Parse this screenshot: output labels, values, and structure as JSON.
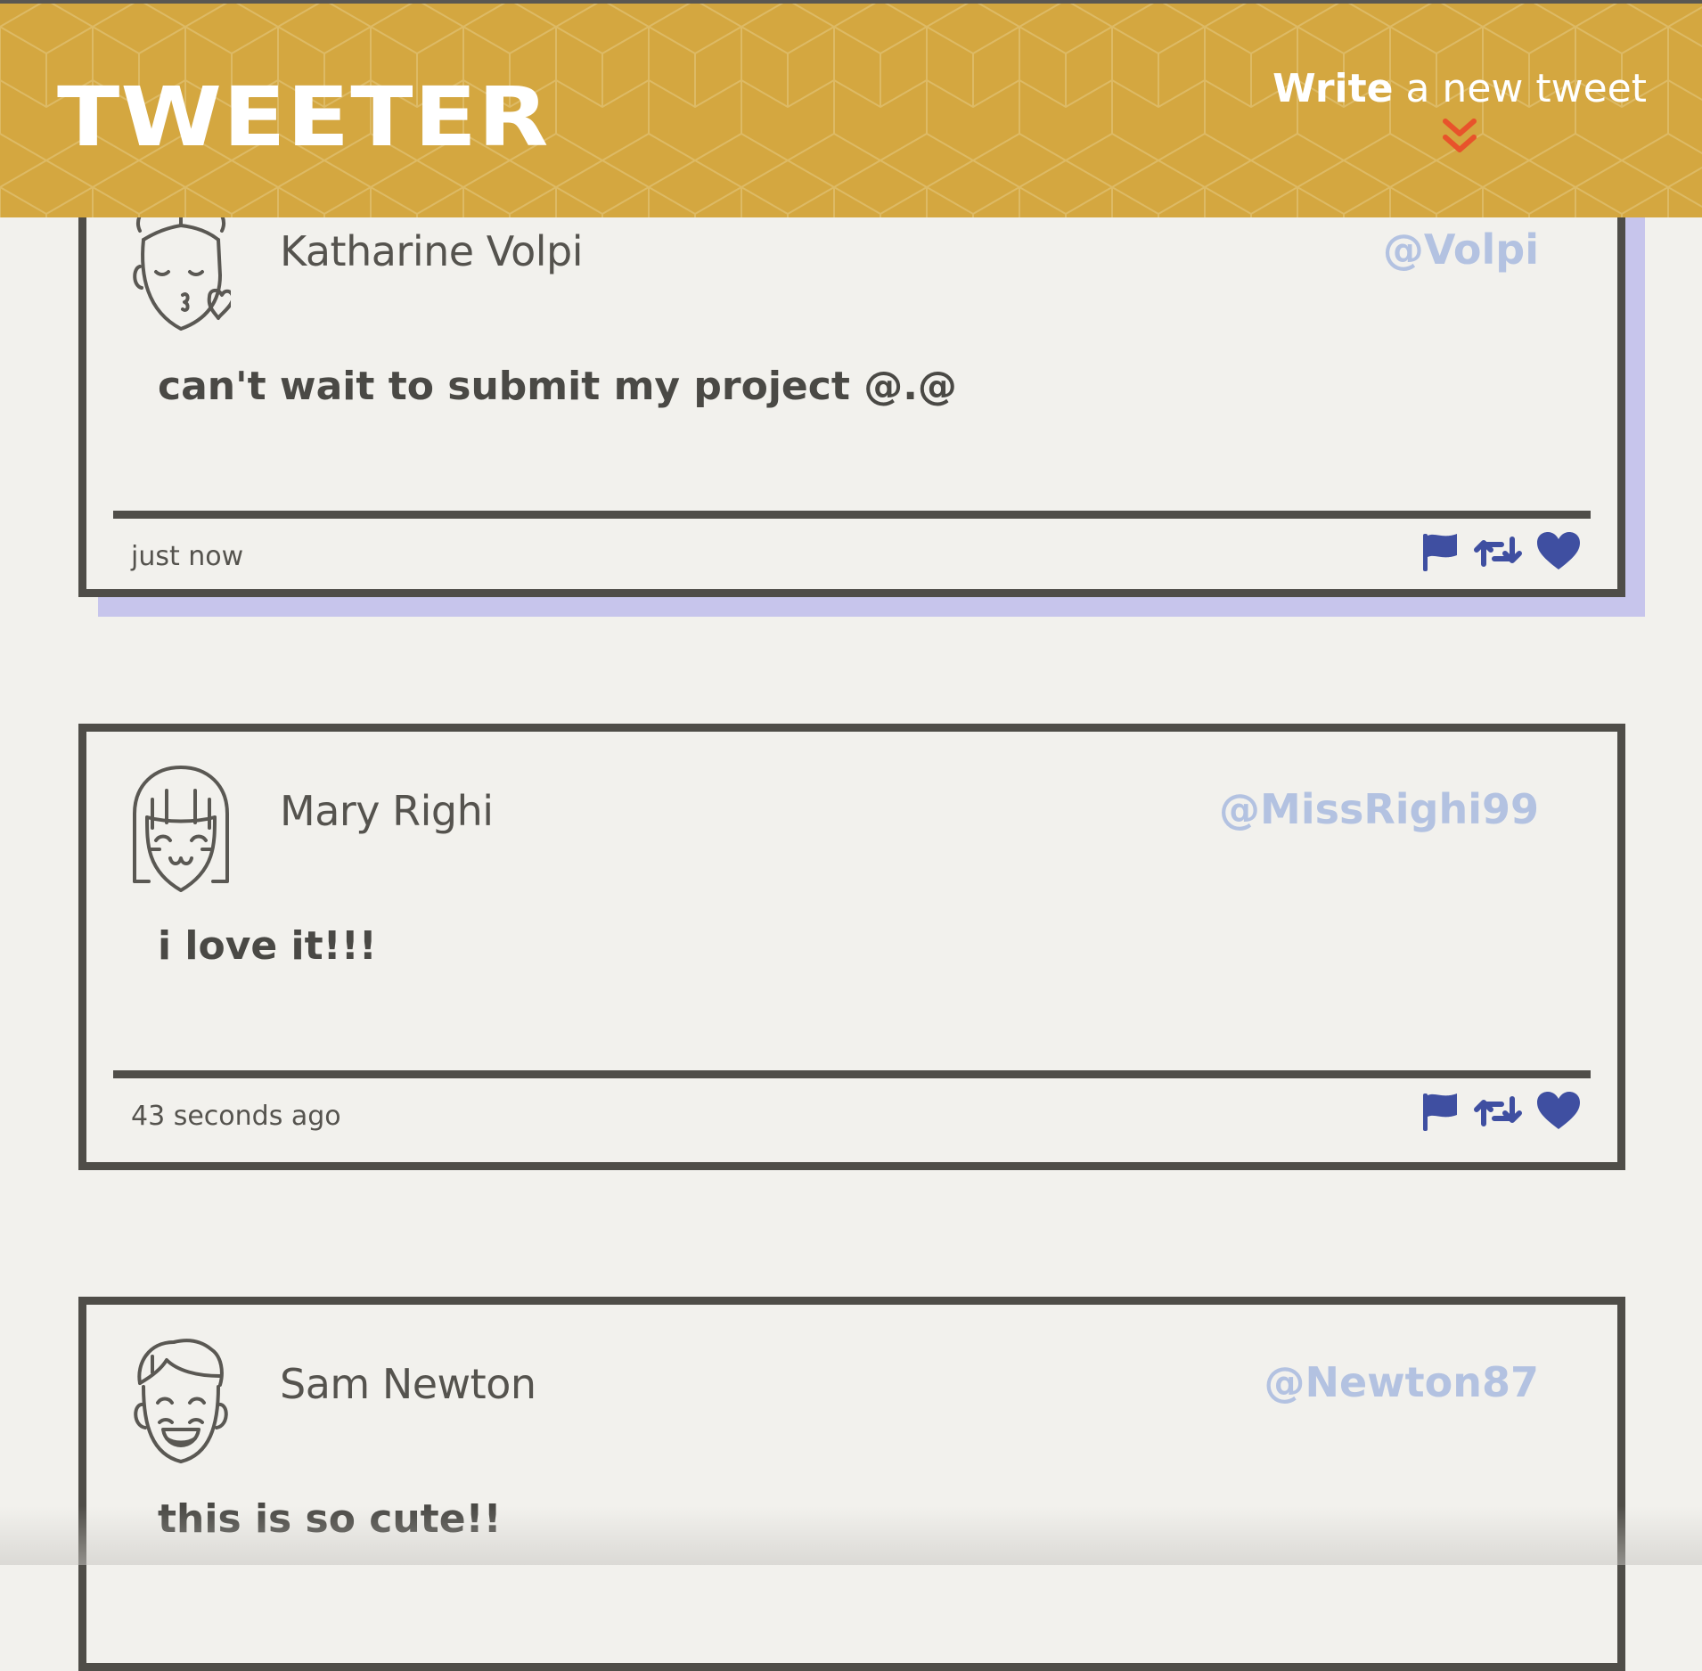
{
  "header": {
    "logo": "TWEETER",
    "compose_strong": "Write",
    "compose_rest": " a new tweet",
    "colors": {
      "bar": "#d4a740",
      "chevron": "#e8532b"
    }
  },
  "tweets": [
    {
      "name": "Katharine Volpi",
      "handle": "@Volpi",
      "text": "can't wait to submit my project @.@",
      "time": "just now",
      "avatar": "kissing-face-avatar",
      "hovered": true
    },
    {
      "name": "Mary Righi",
      "handle": "@MissRighi99",
      "text": "i love it!!!",
      "time": "43 seconds ago",
      "avatar": "bangs-girl-avatar",
      "hovered": false
    },
    {
      "name": "Sam Newton",
      "handle": "@Newton87",
      "text": "this is so cute!!",
      "time": "",
      "avatar": "laughing-boy-avatar",
      "hovered": false
    }
  ],
  "icons": [
    "flag-icon",
    "retweet-icon",
    "heart-icon"
  ],
  "colors": {
    "action_icons": "#3f4fa1",
    "handle": "#b3c2e1",
    "hover_shadow": "#c7c5ec"
  }
}
